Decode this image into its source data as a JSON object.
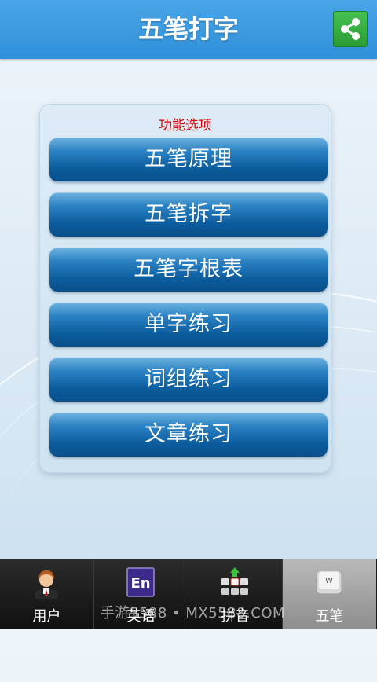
{
  "header": {
    "title": "五笔打字"
  },
  "panel": {
    "title": "功能选项",
    "items": [
      {
        "label": "五笔原理"
      },
      {
        "label": "五笔拆字"
      },
      {
        "label": "五笔字根表"
      },
      {
        "label": "单字练习"
      },
      {
        "label": "词组练习"
      },
      {
        "label": "文章练习"
      }
    ]
  },
  "tabs": [
    {
      "label": "用户",
      "icon": "user-avatar-icon"
    },
    {
      "label": "英语",
      "icon": "en-book-icon"
    },
    {
      "label": "拼音",
      "icon": "keyboard-icon"
    },
    {
      "label": "五笔",
      "icon": "w-key-icon"
    }
  ],
  "active_tab": "五笔",
  "watermark": "手游5588 • MX5588.COM",
  "colors": {
    "header": "#2f8fd8",
    "share": "#2a9c35",
    "button": "#0c5d9e",
    "panel_title": "#d00000"
  }
}
